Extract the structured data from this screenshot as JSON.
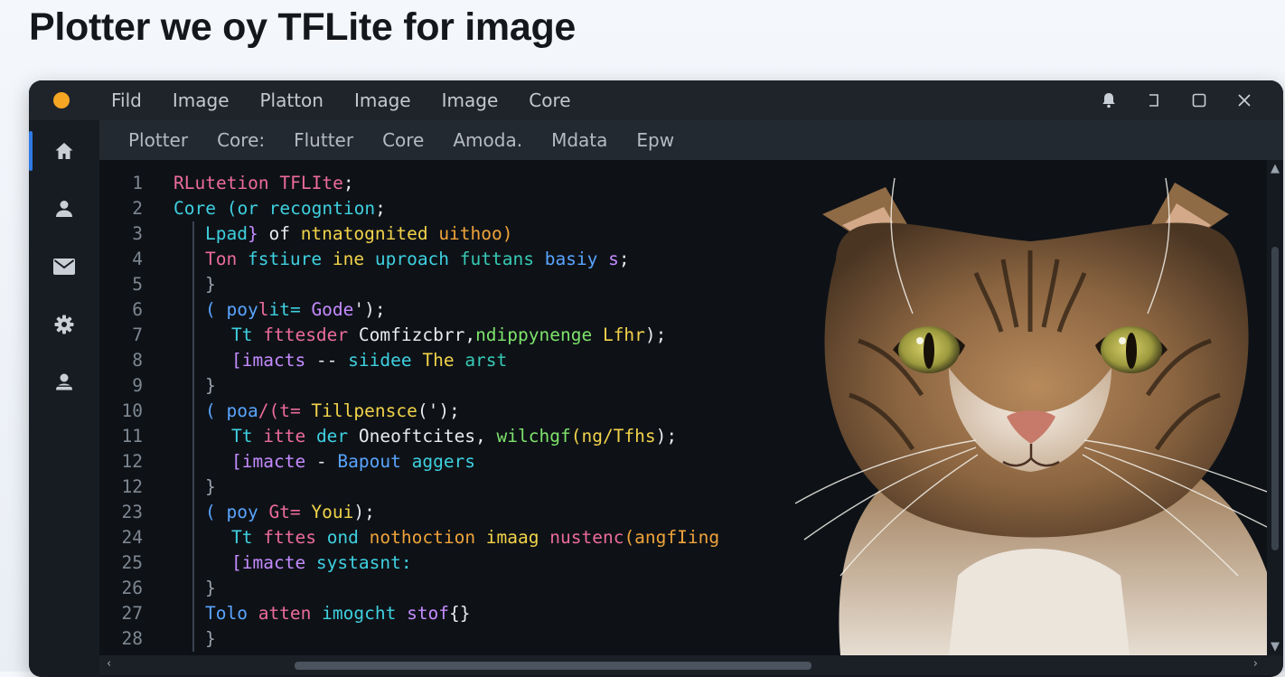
{
  "page": {
    "title": "Plotter we oy TFLite for image"
  },
  "window": {
    "menu": [
      "Fild",
      "Image",
      "Platton",
      "Image",
      "Image",
      "Core"
    ],
    "tabs": [
      "Plotter",
      "Core:",
      "Flutter",
      "Core",
      "Amoda.",
      "Mdata",
      "Epw"
    ],
    "controls": [
      "bell-icon",
      "minimize-icon",
      "maximize-icon",
      "close-icon"
    ],
    "sidebar": [
      "home-icon",
      "user-icon",
      "mail-icon",
      "settings-icon",
      "account-icon"
    ],
    "accent": "#2f7ae5",
    "app_dot_color": "#f5a623"
  },
  "code": [
    {
      "n": "1",
      "indent": 0,
      "parts": [
        [
          "RLutetion TFLIte",
          "pink"
        ],
        [
          ";",
          "white"
        ]
      ]
    },
    {
      "n": "2",
      "indent": 0,
      "parts": [
        [
          "Core (or recogntion",
          "cyan"
        ],
        [
          ";",
          "white"
        ]
      ]
    },
    {
      "n": "3",
      "indent": 1,
      "parts": [
        [
          "Lpad",
          "cyan"
        ],
        [
          "} ",
          "violet"
        ],
        [
          "of ",
          "white"
        ],
        [
          "ntnatognited ",
          "yellow"
        ],
        [
          "uithoo)",
          "orange"
        ]
      ]
    },
    {
      "n": "4",
      "indent": 1,
      "parts": [
        [
          "Ton ",
          "pink"
        ],
        [
          "fstiure ",
          "cyan"
        ],
        [
          "ine ",
          "yellow"
        ],
        [
          "uproach ",
          "cyan"
        ],
        [
          "futtans ",
          "teal"
        ],
        [
          "basiy ",
          "blue"
        ],
        [
          "s",
          "violet"
        ],
        [
          ";",
          "white"
        ]
      ]
    },
    {
      "n": "5",
      "indent": 1,
      "parts": [
        [
          "}",
          "grey"
        ]
      ]
    },
    {
      "n": "6",
      "indent": 1,
      "parts": [
        [
          "( ",
          "blue"
        ],
        [
          "poy",
          "blue"
        ],
        [
          "l",
          "pink"
        ],
        [
          "it= ",
          "cyan"
        ],
        [
          "Gode",
          "violet"
        ],
        [
          "'",
          "white"
        ],
        [
          ");",
          "white"
        ]
      ]
    },
    {
      "n": "7",
      "indent": 2,
      "parts": [
        [
          "Tt ",
          "cyan"
        ],
        [
          "fttesder ",
          "pink"
        ],
        [
          "Comfizcbrr",
          "white"
        ],
        [
          ",",
          "white"
        ],
        [
          "ndippynenge ",
          "green"
        ],
        [
          "Lfhr",
          "yellow"
        ],
        [
          ");",
          "white"
        ]
      ]
    },
    {
      "n": "8",
      "indent": 2,
      "parts": [
        [
          "[imacts ",
          "violet"
        ],
        [
          "-- ",
          "white"
        ],
        [
          "siidee ",
          "cyan"
        ],
        [
          "The ",
          "yellow"
        ],
        [
          "arst",
          "teal"
        ]
      ]
    },
    {
      "n": "9",
      "indent": 1,
      "parts": [
        [
          "}",
          "grey"
        ]
      ]
    },
    {
      "n": "10",
      "indent": 1,
      "parts": [
        [
          "( ",
          "blue"
        ],
        [
          "poa",
          "blue"
        ],
        [
          "/(t= ",
          "pink"
        ],
        [
          "Tillpensce",
          "yellow"
        ],
        [
          "('",
          "white"
        ],
        [
          ");",
          "white"
        ]
      ]
    },
    {
      "n": "11",
      "indent": 2,
      "parts": [
        [
          "Tt ",
          "cyan"
        ],
        [
          "itte ",
          "pink"
        ],
        [
          "der ",
          "cyan"
        ],
        [
          "Oneoftcites",
          "white"
        ],
        [
          ", ",
          "white"
        ],
        [
          "wilchgf",
          "green"
        ],
        [
          "(ng/Tfhs",
          "yellow"
        ],
        [
          ");",
          "white"
        ]
      ]
    },
    {
      "n": "12",
      "indent": 2,
      "parts": [
        [
          "[imacte ",
          "violet"
        ],
        [
          "- ",
          "white"
        ],
        [
          "Bapout ",
          "blue"
        ],
        [
          "aggers",
          "cyan"
        ]
      ]
    },
    {
      "n": "12",
      "indent": 1,
      "parts": [
        [
          "}",
          "grey"
        ]
      ]
    },
    {
      "n": "23",
      "indent": 1,
      "parts": [
        [
          "( ",
          "blue"
        ],
        [
          "poy ",
          "blue"
        ],
        [
          "Gt= ",
          "pink"
        ],
        [
          "Youi",
          "yellow"
        ],
        [
          ");",
          "white"
        ]
      ]
    },
    {
      "n": "24",
      "indent": 2,
      "parts": [
        [
          "Tt ",
          "cyan"
        ],
        [
          "fttes ",
          "pink"
        ],
        [
          "ond ",
          "cyan"
        ],
        [
          "nothoction ",
          "orange"
        ],
        [
          "imaag ",
          "yellow"
        ],
        [
          "nustenc",
          "pink"
        ],
        [
          "(angfIing",
          "orange"
        ]
      ]
    },
    {
      "n": "25",
      "indent": 2,
      "parts": [
        [
          "[imacte ",
          "violet"
        ],
        [
          "systasnt:",
          "cyan"
        ]
      ]
    },
    {
      "n": "26",
      "indent": 1,
      "parts": [
        [
          "}",
          "grey"
        ]
      ]
    },
    {
      "n": "27",
      "indent": 1,
      "parts": [
        [
          "Tolo ",
          "blue"
        ],
        [
          "atten ",
          "pink"
        ],
        [
          "imogcht ",
          "cyan"
        ],
        [
          "stof",
          "violet"
        ],
        [
          "{}",
          "white"
        ]
      ]
    },
    {
      "n": "28",
      "indent": 1,
      "parts": [
        [
          "}",
          "grey"
        ]
      ]
    }
  ],
  "image": {
    "subject": "tabby-cat-photo"
  }
}
